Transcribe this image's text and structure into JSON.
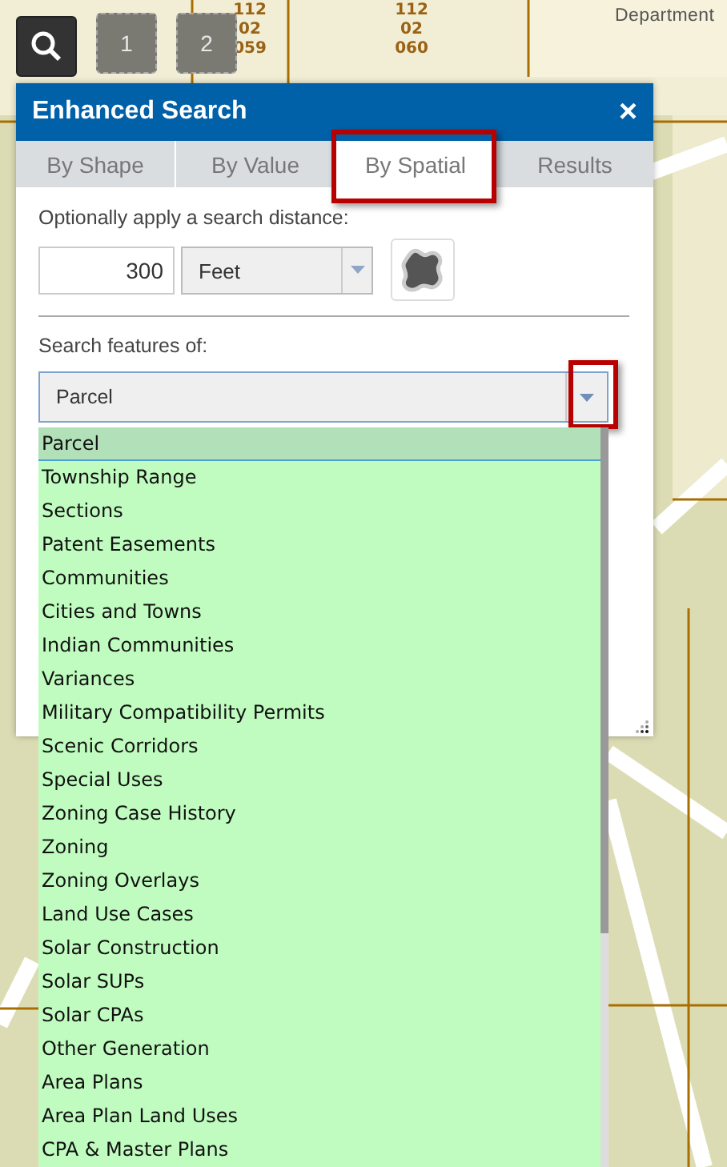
{
  "map": {
    "parcel_labels": [
      {
        "lines": [
          "112",
          "02",
          "059"
        ]
      },
      {
        "lines": [
          "112",
          "02",
          "060"
        ]
      }
    ],
    "place_label": "Department"
  },
  "toolbar": {
    "buttons": [
      {
        "label": "1"
      },
      {
        "label": "2"
      }
    ]
  },
  "panel": {
    "title": "Enhanced Search",
    "close": "×",
    "tabs": [
      {
        "label": "By Shape",
        "selected": false,
        "highlighted": false
      },
      {
        "label": "By Value",
        "selected": false,
        "highlighted": false
      },
      {
        "label": "By Spatial",
        "selected": true,
        "highlighted": true
      },
      {
        "label": "Results",
        "selected": false,
        "highlighted": false
      }
    ],
    "distance_label": "Optionally apply a search distance:",
    "distance": {
      "value": "300",
      "unit": "Feet"
    },
    "features_label": "Search features of:",
    "features_select": {
      "value": "Parcel",
      "highlighted": true
    },
    "features_list": [
      {
        "label": "Parcel",
        "selected": true
      },
      {
        "label": "Township Range",
        "selected": false
      },
      {
        "label": "Sections",
        "selected": false
      },
      {
        "label": "Patent Easements",
        "selected": false
      },
      {
        "label": "Communities",
        "selected": false
      },
      {
        "label": "Cities and Towns",
        "selected": false
      },
      {
        "label": "Indian Communities",
        "selected": false
      },
      {
        "label": "Variances",
        "selected": false
      },
      {
        "label": "Military Compatibility Permits",
        "selected": false
      },
      {
        "label": "Scenic Corridors",
        "selected": false
      },
      {
        "label": "Special Uses",
        "selected": false
      },
      {
        "label": "Zoning Case History",
        "selected": false
      },
      {
        "label": "Zoning",
        "selected": false
      },
      {
        "label": "Zoning Overlays",
        "selected": false
      },
      {
        "label": "Land Use Cases",
        "selected": false
      },
      {
        "label": "Solar Construction",
        "selected": false
      },
      {
        "label": "Solar SUPs",
        "selected": false
      },
      {
        "label": "Solar CPAs",
        "selected": false
      },
      {
        "label": "Other Generation",
        "selected": false
      },
      {
        "label": "Area Plans",
        "selected": false
      },
      {
        "label": "Area Plan Land Uses",
        "selected": false
      },
      {
        "label": "CPA & Master Plans",
        "selected": false
      }
    ]
  }
}
